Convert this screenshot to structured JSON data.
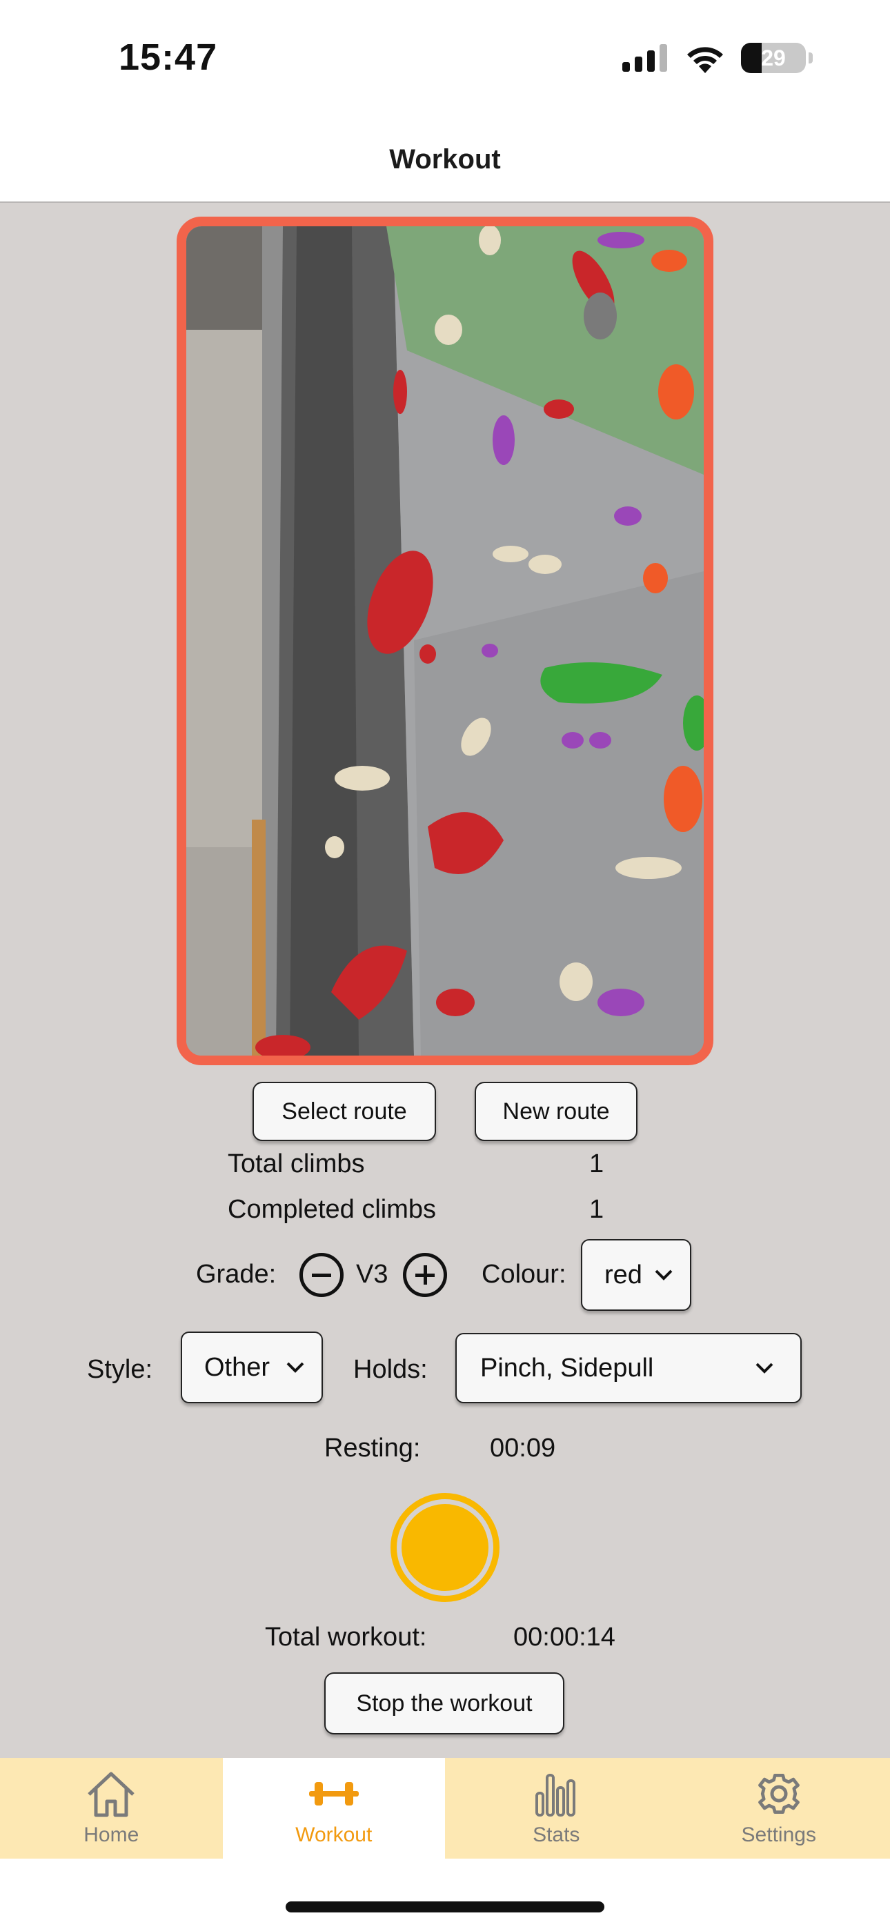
{
  "status_bar": {
    "time": "15:47",
    "battery_level": "29"
  },
  "nav": {
    "title": "Workout"
  },
  "route_photo": {
    "alt": "Climbing wall with coloured holds",
    "frame_color": "#f2644b"
  },
  "buttons": {
    "select_route": "Select route",
    "new_route": "New route",
    "stop_workout": "Stop the workout"
  },
  "stats": {
    "total_climbs_label": "Total climbs",
    "total_climbs_value": "1",
    "completed_climbs_label": "Completed climbs",
    "completed_climbs_value": "1"
  },
  "grade": {
    "label": "Grade:",
    "value": "V3"
  },
  "colour": {
    "label": "Colour:",
    "value": "red"
  },
  "style": {
    "label": "Style:",
    "value": "Other"
  },
  "holds": {
    "label": "Holds:",
    "value": "Pinch, Sidepull"
  },
  "resting": {
    "label": "Resting:",
    "value": "00:09"
  },
  "total_workout": {
    "label": "Total workout:",
    "value": "00:00:14"
  },
  "colors": {
    "accent": "#f9b800",
    "tab_bg": "#fde8b3",
    "tab_active": "#f29a0f",
    "page_bg": "#d6d2d0"
  },
  "tabs": [
    {
      "label": "Home",
      "icon": "home-icon",
      "active": false
    },
    {
      "label": "Workout",
      "icon": "dumbbell-icon",
      "active": true
    },
    {
      "label": "Stats",
      "icon": "bar-chart-icon",
      "active": false
    },
    {
      "label": "Settings",
      "icon": "gear-icon",
      "active": false
    }
  ]
}
